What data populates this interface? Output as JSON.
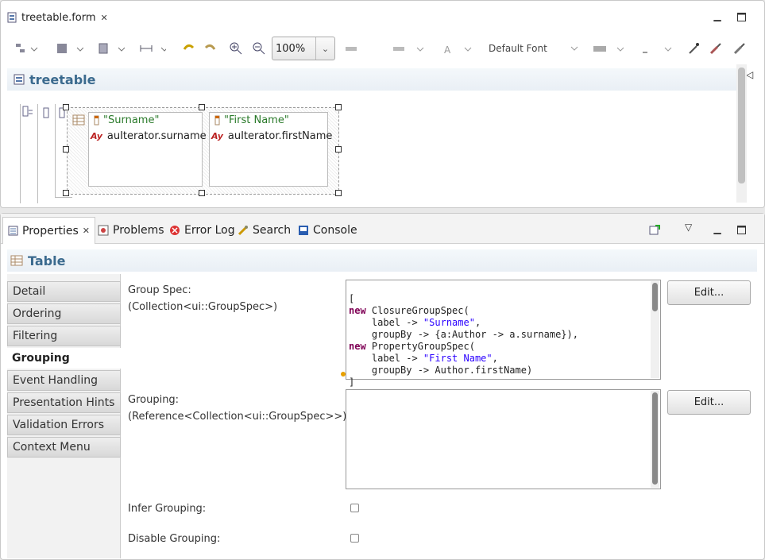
{
  "editor": {
    "tab_label": "treetable.form",
    "zoom": "100%",
    "font": "Default Font",
    "form_title": "treetable",
    "columns": [
      {
        "header": "\"Surname\"",
        "binding": "auIterator.surname"
      },
      {
        "header": "\"First Name\"",
        "binding": "auIterator.firstName"
      }
    ]
  },
  "properties": {
    "tabs": [
      "Properties",
      "Problems",
      "Error Log",
      "Search",
      "Console"
    ],
    "section_title": "Table",
    "sidebar": [
      "Detail",
      "Ordering",
      "Filtering",
      "Grouping",
      "Event Handling",
      "Presentation Hints",
      "Validation Errors",
      "Context Menu"
    ],
    "selected_sidebar": "Grouping",
    "group_spec_label": "Group Spec:",
    "group_spec_type": "(Collection<ui::GroupSpec>)",
    "grouping_label": "Grouping:",
    "grouping_type": "(Reference<Collection<ui::GroupSpec>>)",
    "infer_label": "Infer Grouping:",
    "disable_label": "Disable Grouping:",
    "edit_label": "Edit...",
    "code": {
      "l1": "[",
      "l2_kw": "new",
      "l2": " ClosureGroupSpec(",
      "l3a": "    label -> ",
      "l3s": "\"Surname\"",
      "l3b": ",",
      "l4": "    groupBy -> {a:Author -> a.surname}),",
      "l5_kw": "new",
      "l5": " PropertyGroupSpec(",
      "l6a": "    label -> ",
      "l6s": "\"First Name\"",
      "l6b": ",",
      "l7": "    groupBy -> Author.firstName)",
      "l8": "]"
    }
  }
}
